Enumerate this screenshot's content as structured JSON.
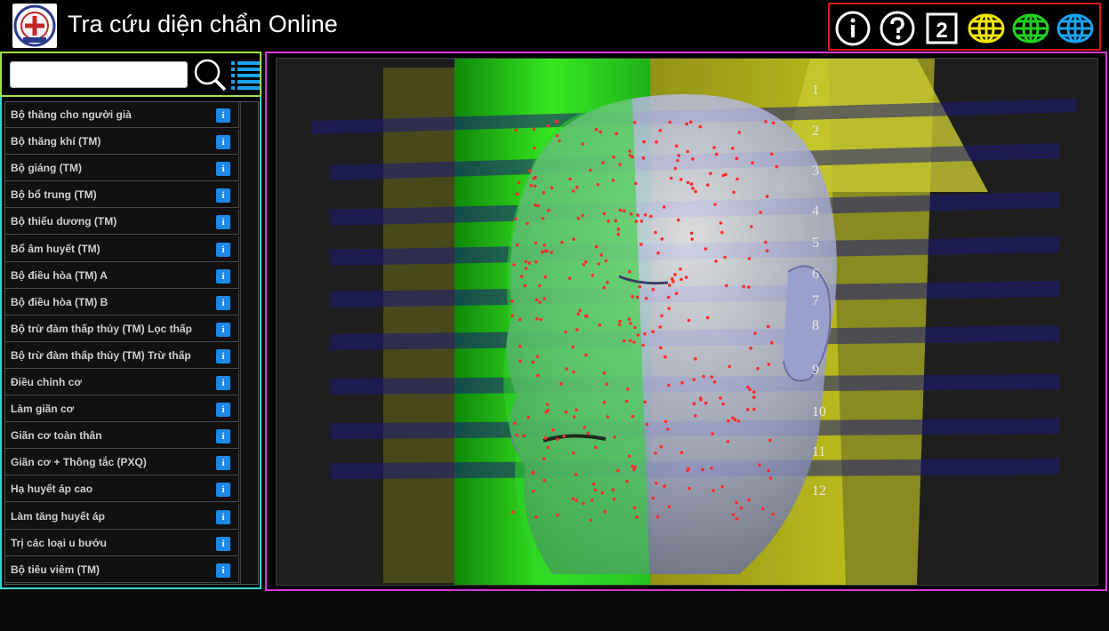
{
  "header": {
    "title": "Tra cứu diện chẩn Online",
    "logo_icon": "clinic-seal-logo",
    "toolbar": [
      {
        "icon": "info-icon",
        "color": "#ffffff"
      },
      {
        "icon": "help-icon",
        "color": "#ffffff"
      },
      {
        "icon": "view-2-icon",
        "label": "2",
        "color": "#ffffff"
      },
      {
        "icon": "globe-yellow-icon",
        "color": "#f2e600"
      },
      {
        "icon": "globe-green-icon",
        "color": "#1fd21f"
      },
      {
        "icon": "globe-blue-icon",
        "color": "#1aa3f0"
      }
    ]
  },
  "search": {
    "value": "",
    "placeholder": "",
    "search_icon": "magnifier-icon",
    "list_icon": "list-icon"
  },
  "remedies": [
    {
      "label": "Bộ thăng cho người già"
    },
    {
      "label": "Bộ thăng khí (TM)"
    },
    {
      "label": "Bộ giáng (TM)"
    },
    {
      "label": "Bộ bổ trung (TM)"
    },
    {
      "label": "Bộ thiếu dương (TM)"
    },
    {
      "label": "Bổ âm huyết (TM)"
    },
    {
      "label": "Bộ điều hòa (TM) A"
    },
    {
      "label": "Bộ điều hòa (TM) B"
    },
    {
      "label": "Bộ trừ đàm thấp thủy (TM) Lọc thấp"
    },
    {
      "label": "Bộ trừ đàm thấp thủy (TM) Trừ thấp"
    },
    {
      "label": "Điều chỉnh cơ"
    },
    {
      "label": "Làm giãn cơ"
    },
    {
      "label": "Giãn cơ toàn thân"
    },
    {
      "label": "Giãn cơ + Thông tắc (PXQ)"
    },
    {
      "label": "Hạ huyết áp cao"
    },
    {
      "label": "Làm tăng huyết áp"
    },
    {
      "label": "Trị các loại u bướu"
    },
    {
      "label": "Bộ tiêu viêm (TM)"
    }
  ],
  "info_button_label": "i",
  "viewer": {
    "zone_numbers": [
      "1",
      "2",
      "3",
      "4",
      "5",
      "6",
      "7",
      "8",
      "9",
      "10",
      "11",
      "12"
    ],
    "colors": {
      "plane_yellow": "#b8b820",
      "plane_blue": "#1a1a7a",
      "plane_green": "#22cc22",
      "point": "#ff2a2a",
      "face": "#c4c8f0"
    }
  }
}
